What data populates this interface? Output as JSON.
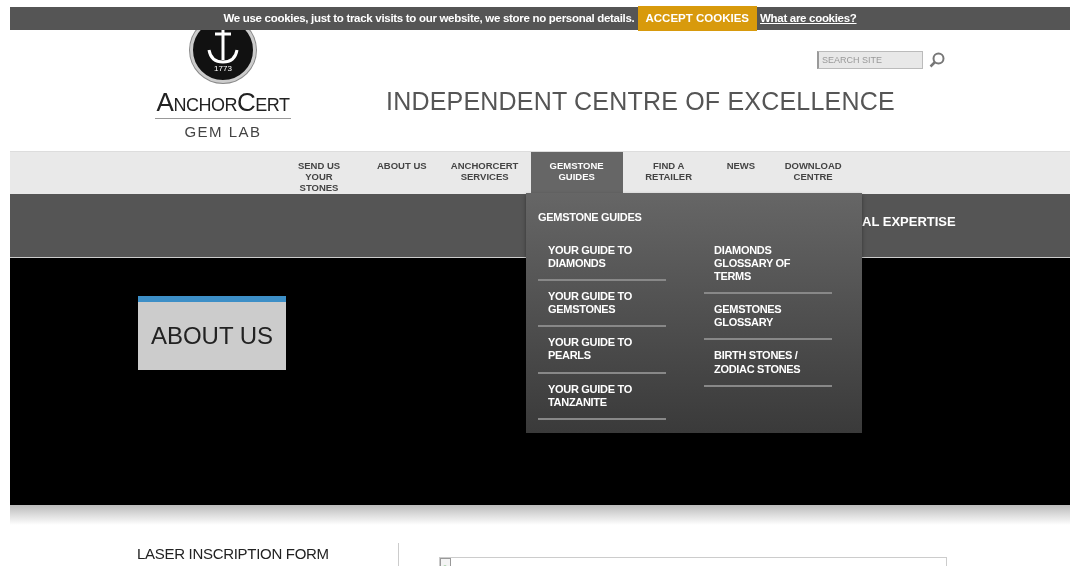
{
  "cookie_bar": {
    "message": "We use cookies, just to track visits to our website, we store no personal details.",
    "accept_button": "ACCEPT COOKIES",
    "link": "What are cookies?"
  },
  "header": {
    "logo": {
      "year": "1773",
      "name": "AnchorCert",
      "subtitle": "GEM LAB"
    },
    "search": {
      "placeholder": "SEARCH SITE"
    },
    "tagline": "INDEPENDENT CENTRE OF EXCELLENCE"
  },
  "nav": {
    "items": [
      {
        "label": "SEND US YOUR STONES",
        "selected": false
      },
      {
        "label": "ABOUT US",
        "selected": false
      },
      {
        "label": "ANCHORCERT SERVICES",
        "selected": false
      },
      {
        "label": "GEMSTONE GUIDES",
        "selected": true
      },
      {
        "label": "FIND A RETAILER",
        "selected": false
      },
      {
        "label": "NEWS",
        "selected": false
      },
      {
        "label": "DOWNLOAD CENTRE",
        "selected": false
      }
    ]
  },
  "dropdown": {
    "heading": "GEMSTONE GUIDES",
    "columns": [
      [
        "YOUR GUIDE TO DIAMONDS",
        "YOUR GUIDE TO GEMSTONES",
        "YOUR GUIDE TO PEARLS",
        "YOUR GUIDE TO TANZANITE"
      ],
      [
        "DIAMONDS GLOSSARY OF TERMS",
        "GEMSTONES GLOSSARY",
        "BIRTH STONES / ZODIAC STONES"
      ]
    ]
  },
  "banner": {
    "text": "AL EXPERTISE"
  },
  "hero": {
    "title": "ABOUT US"
  },
  "content": {
    "sidebar_heading": "LASER INSCRIPTION FORM"
  }
}
